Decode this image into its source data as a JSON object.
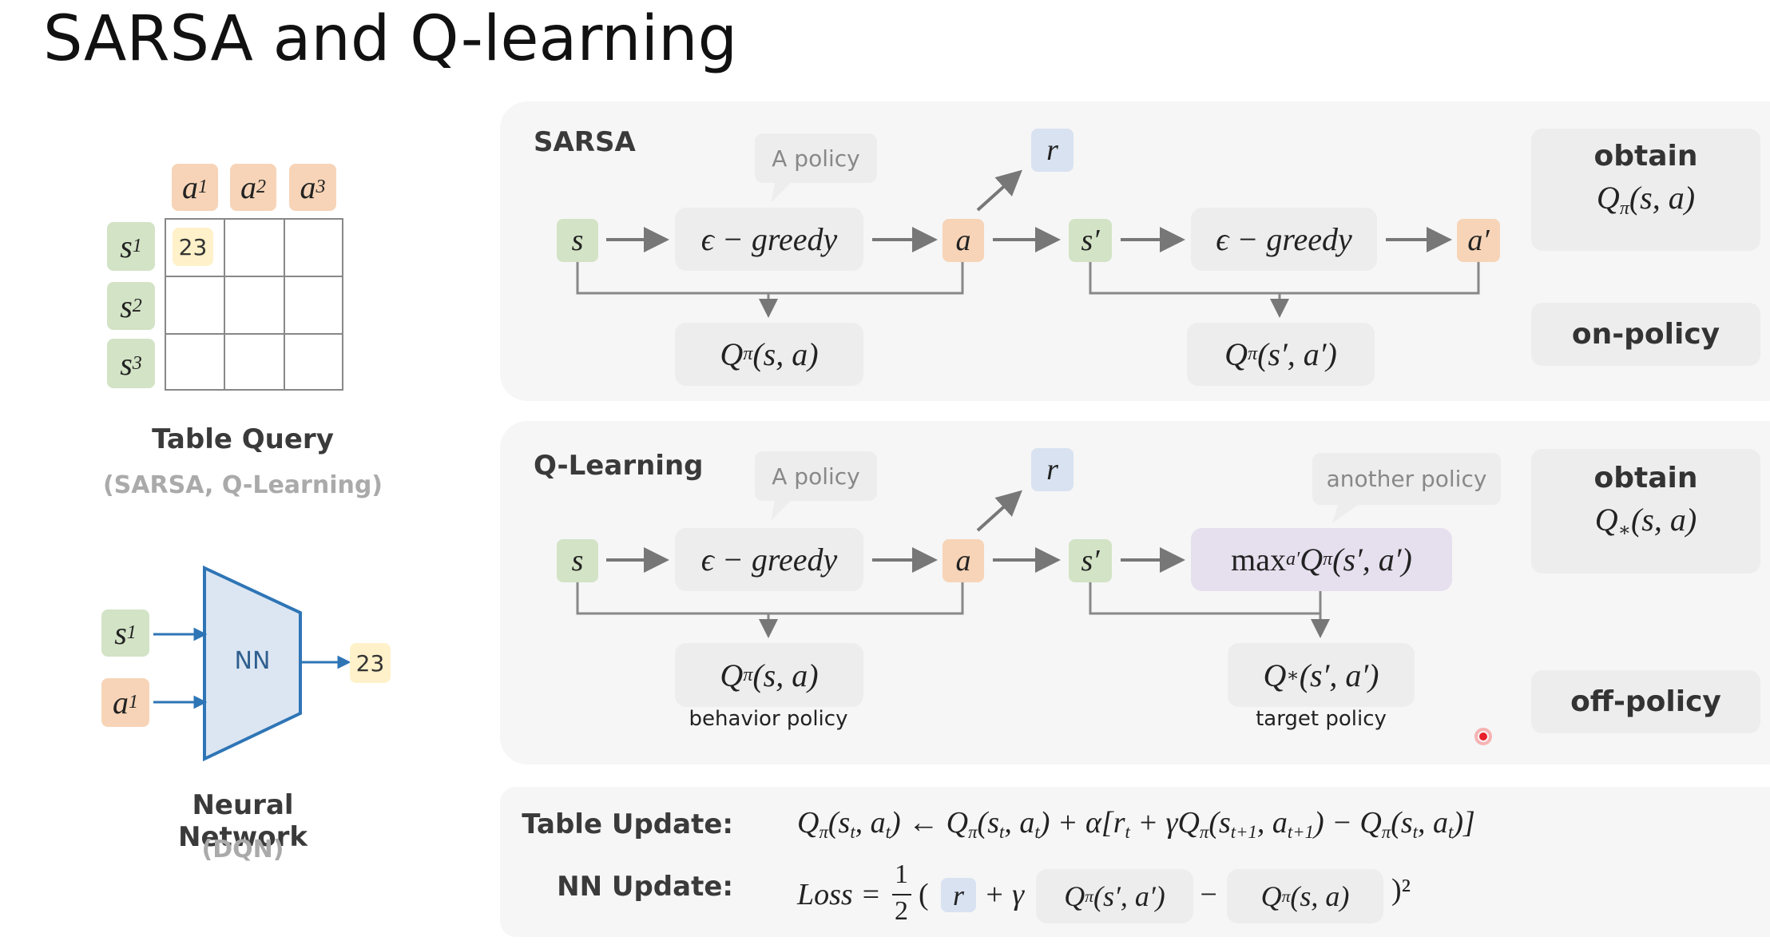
{
  "title": "SARSA and Q-learning",
  "left": {
    "table": {
      "actions": [
        [
          "a",
          "1"
        ],
        [
          "a",
          "2"
        ],
        [
          "a",
          "3"
        ]
      ],
      "states": [
        [
          "s",
          "1"
        ],
        [
          "s",
          "2"
        ],
        [
          "s",
          "3"
        ]
      ],
      "value": "23",
      "caption": "Table Query",
      "subcaption": "(SARSA, Q-Learning)"
    },
    "nn": {
      "inputs": [
        [
          "s",
          "1"
        ],
        [
          "a",
          "1"
        ]
      ],
      "label": "NN",
      "output": "23",
      "caption": "Neural Network",
      "subcaption": "(DQN)"
    }
  },
  "sarsa": {
    "label": "SARSA",
    "bubble": "A policy",
    "r": "r",
    "s": "s",
    "greedy": "ϵ − greedy",
    "a": "a",
    "s_prime": "s′",
    "greedy2": "ϵ − greedy",
    "a_prime": "a′",
    "q1": [
      [
        "Q",
        "π"
      ],
      [
        "(s, a)",
        ""
      ]
    ],
    "q2": [
      [
        "Q",
        "π"
      ],
      [
        "(s′, a′)",
        ""
      ]
    ],
    "obtain": "obtain",
    "obtain_q": [
      [
        "Q",
        "π"
      ],
      [
        "(s, a)",
        ""
      ]
    ],
    "policy_type": "on-policy"
  },
  "qlearning": {
    "label": "Q-Learning",
    "bubble": "A policy",
    "bubble2": "another policy",
    "r": "r",
    "s": "s",
    "greedy": "ϵ − greedy",
    "a": "a",
    "s_prime": "s′",
    "max": [
      [
        "max",
        "a′"
      ],
      [
        "Q",
        "π"
      ],
      [
        "(s′, a′)",
        ""
      ]
    ],
    "q1": [
      [
        "Q",
        "π"
      ],
      [
        "(s, a)",
        ""
      ]
    ],
    "q1_caption": "behavior policy",
    "q2": [
      [
        "Q",
        "∗"
      ],
      [
        "(s′, a′)",
        ""
      ]
    ],
    "q2_caption": "target policy",
    "obtain": "obtain",
    "obtain_q": [
      [
        "Q",
        "∗"
      ],
      [
        "(s, a)",
        ""
      ]
    ],
    "policy_type": "off-policy"
  },
  "updates": {
    "table_label": "Table Update:",
    "table_formula": [
      [
        "Q",
        "π"
      ],
      [
        "(s",
        "t"
      ],
      [
        ", a",
        "t"
      ],
      [
        ") ← Q",
        "π"
      ],
      [
        "(s",
        "t"
      ],
      [
        ", a",
        "t"
      ],
      [
        ") + α[r",
        "t"
      ],
      [
        " + γQ",
        "π"
      ],
      [
        "(s",
        "t+1"
      ],
      [
        ", a",
        "t+1"
      ],
      [
        ") − Q",
        "π"
      ],
      [
        "(s",
        "t"
      ],
      [
        ", a",
        "t"
      ],
      [
        ")]",
        ""
      ]
    ],
    "nn_label": "NN Update:",
    "loss": "Loss =",
    "frac_num": "1",
    "frac_den": "2",
    "open": "(",
    "r": "r",
    "plus_gamma": "+ γ",
    "target_q": [
      [
        "Q",
        "π"
      ],
      [
        "(s′, a′)",
        ""
      ]
    ],
    "minus": "−",
    "pred_q": [
      [
        "Q",
        "π"
      ],
      [
        "(s, a)",
        ""
      ]
    ],
    "close": ")²"
  },
  "colors": {
    "state": "#d3e3c6",
    "action": "#f7d4b7",
    "reward": "#d8e2f1",
    "value": "#fff1c9",
    "nn_fill": "#dce6f2",
    "nn_stroke": "#2e75b6",
    "cursor": "#e8202a"
  }
}
